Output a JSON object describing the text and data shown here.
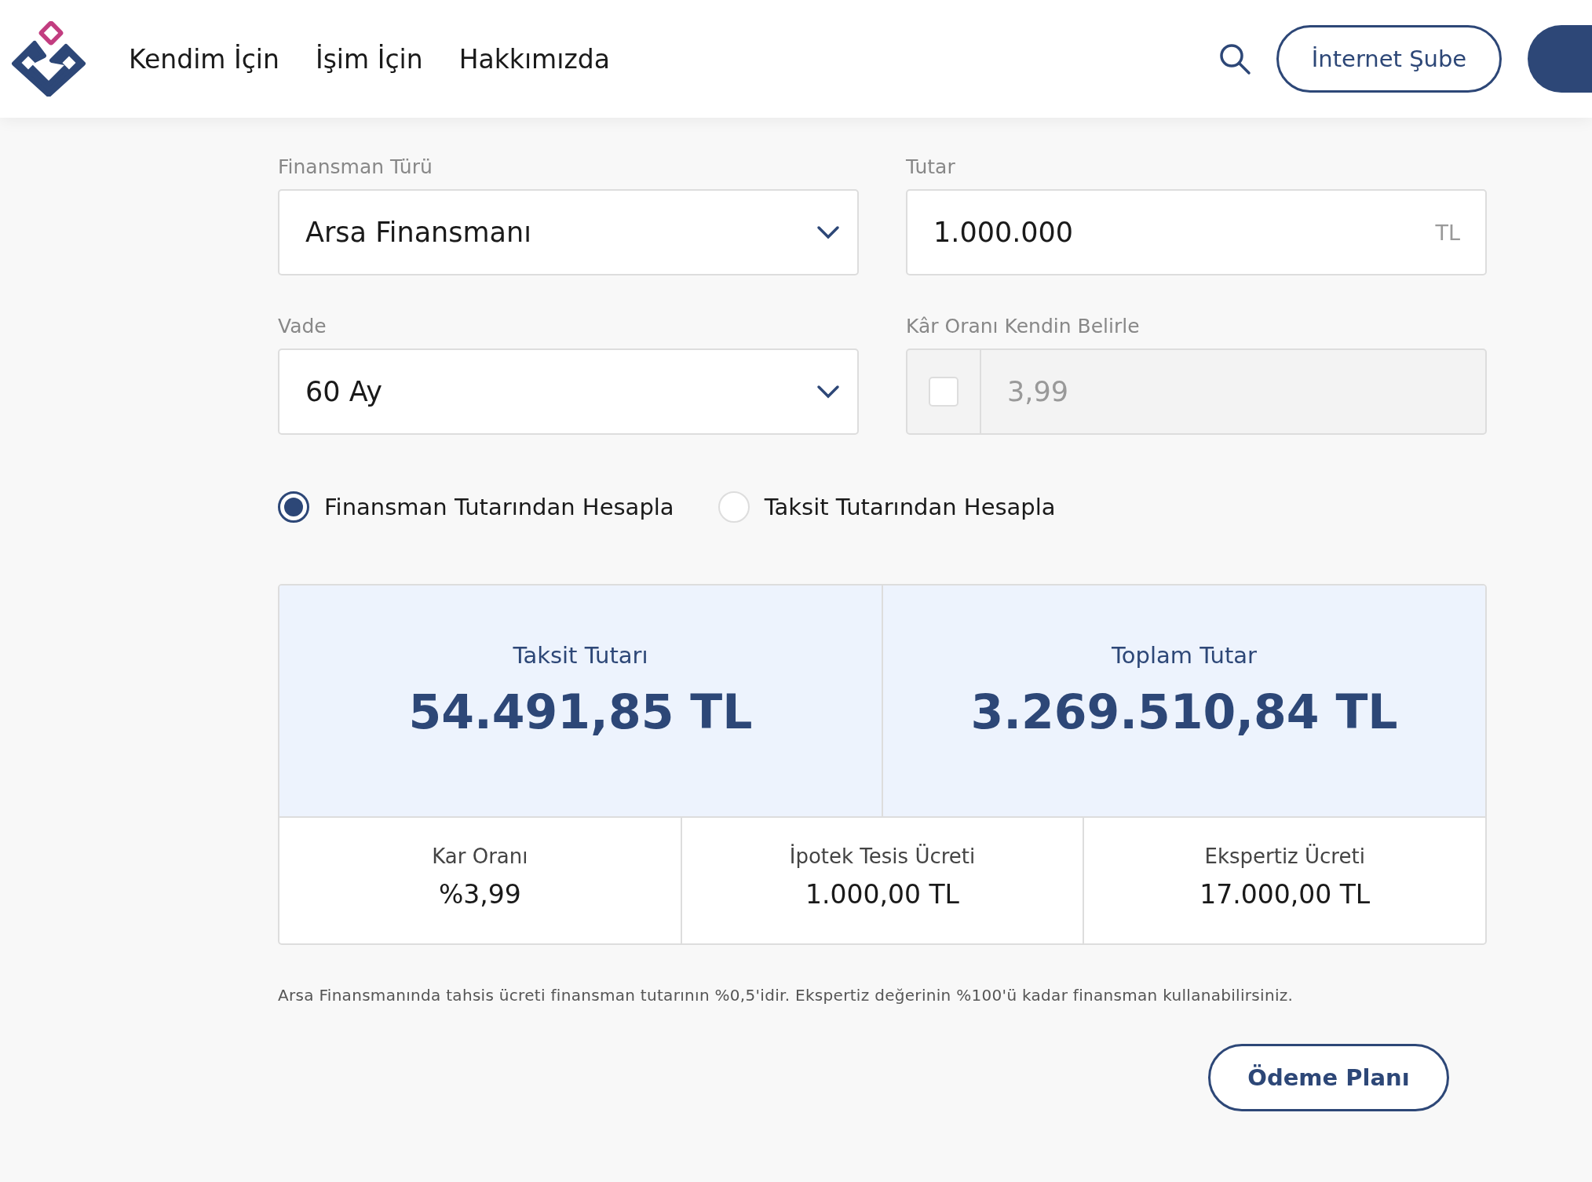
{
  "header": {
    "nav": [
      {
        "label": "Kendim İçin"
      },
      {
        "label": "İşim İçin"
      },
      {
        "label": "Hakkımızda"
      }
    ],
    "buttons": [
      {
        "kind": "outline",
        "label": "İnternet Şube"
      },
      {
        "kind": "filled"
      }
    ]
  },
  "form": {
    "fields": [
      {
        "kind": "select",
        "label": "Finansman Türü",
        "value": "Arsa Finansmanı"
      },
      {
        "kind": "amount",
        "label": "Tutar",
        "value": "1.000.000",
        "suffix": "TL"
      },
      {
        "kind": "select",
        "label": "Vade",
        "value": "60 Ay"
      },
      {
        "kind": "check-input",
        "label": "Kâr Oranı Kendin Belirle",
        "value": "3,99",
        "checked": false,
        "disabled": true
      }
    ],
    "options": [
      {
        "label": "Finansman Tutarından Hesapla",
        "selected": true
      },
      {
        "label": "Taksit Tutarından Hesapla",
        "selected": false
      }
    ]
  },
  "results": {
    "primary": [
      {
        "label": "Taksit Tutarı",
        "value": "54.491,85 TL"
      },
      {
        "label": "Toplam Tutar",
        "value": "3.269.510,84 TL"
      }
    ],
    "secondary": [
      {
        "label": "Kar Oranı",
        "value": "%3,99"
      },
      {
        "label": "İpotek Tesis Ücreti",
        "value": "1.000,00 TL"
      },
      {
        "label": "Ekspertiz Ücreti",
        "value": "17.000,00 TL"
      }
    ]
  },
  "note": "Arsa Finansmanında tahsis ücreti finansman tutarının %0,5'idir. Ekspertiz değerinin %100'ü kadar finansman kullanabilirsiniz.",
  "action": {
    "label": "Ödeme Planı"
  }
}
